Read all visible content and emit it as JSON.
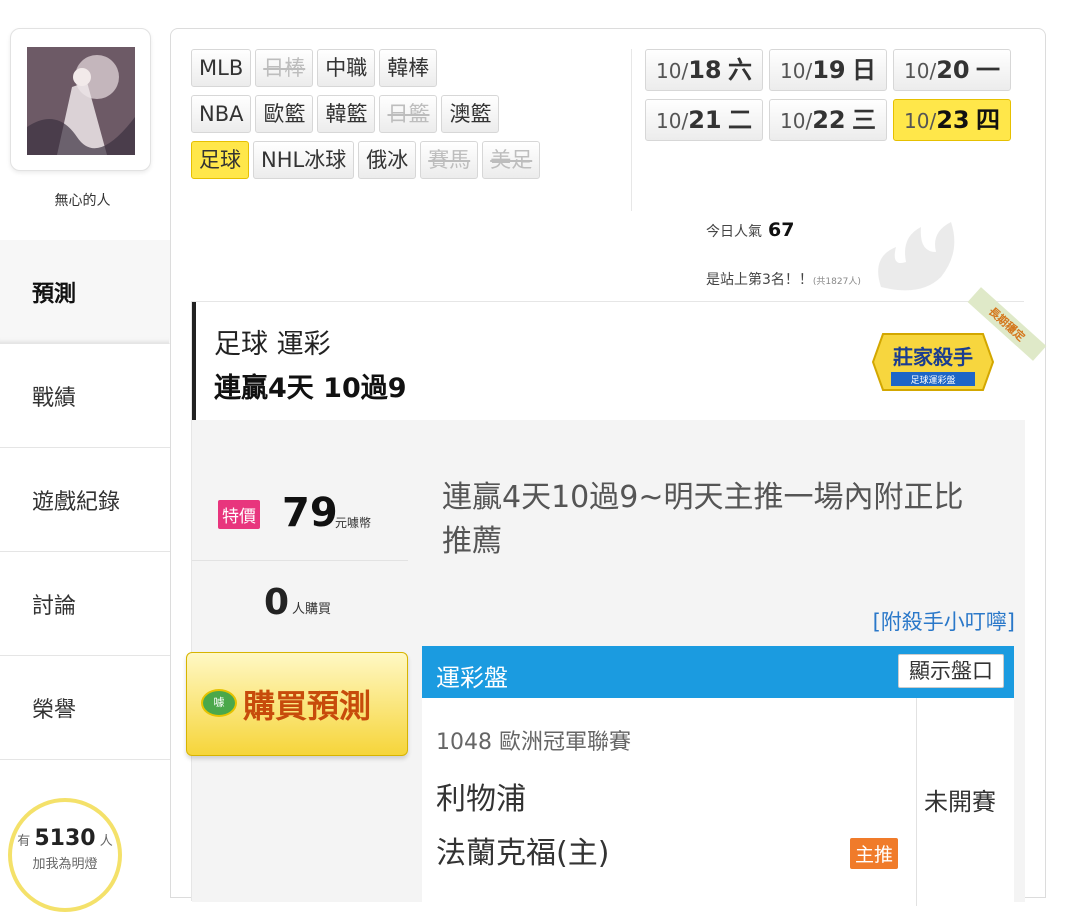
{
  "user": {
    "name": "無心的人"
  },
  "nav": {
    "items": [
      {
        "label": "預測"
      },
      {
        "label": "戰績"
      },
      {
        "label": "遊戲紀錄"
      },
      {
        "label": "討論"
      },
      {
        "label": "榮譽"
      }
    ]
  },
  "fans": {
    "prefix": "有",
    "count": "5130",
    "suffix": "人",
    "caption": "加我為明燈"
  },
  "sports": [
    {
      "label": "MLB"
    },
    {
      "label": "日棒"
    },
    {
      "label": "中職"
    },
    {
      "label": "韓棒"
    },
    {
      "label": "NBA"
    },
    {
      "label": "歐籃"
    },
    {
      "label": "韓籃"
    },
    {
      "label": "日籃"
    },
    {
      "label": "澳籃"
    },
    {
      "label": "足球"
    },
    {
      "label": "NHL冰球"
    },
    {
      "label": "俄冰"
    },
    {
      "label": "賽馬"
    },
    {
      "label": "美足"
    }
  ],
  "dates": [
    {
      "month": "10/",
      "day": "18",
      "weekday": "六"
    },
    {
      "month": "10/",
      "day": "19",
      "weekday": "日"
    },
    {
      "month": "10/",
      "day": "20",
      "weekday": "一"
    },
    {
      "month": "10/",
      "day": "21",
      "weekday": "二"
    },
    {
      "month": "10/",
      "day": "22",
      "weekday": "三"
    },
    {
      "month": "10/",
      "day": "23",
      "weekday": "四"
    }
  ],
  "stats": {
    "popularity_label": "今日人氣",
    "popularity_value": "67",
    "rank_text": "是站上第3名！！",
    "rank_total": "(共1827人)"
  },
  "prediction": {
    "category": "足球 運彩",
    "streak": "連贏4天 10過9",
    "badge_title": "莊家殺手",
    "badge_subtitle": "足球運彩盤",
    "ribbon": "長期穩定",
    "special_tag": "特價",
    "price": "79",
    "currency": "元噱幣",
    "buyers": "0",
    "buyers_label": "人購買",
    "description": "連贏4天10過9~明天主推一場內附正比推薦",
    "tip_link": "[附殺手小叮嚀]",
    "buy_icon": "噱",
    "buy_label": "購買預測"
  },
  "table": {
    "header": "運彩盤",
    "show_odds": "顯示盤口",
    "match_id": "1048 歐洲冠軍聯賽",
    "team_away": "利物浦",
    "team_home": "法蘭克福(主)",
    "status": "未開賽",
    "main_pick": "主推"
  },
  "colors": {
    "accent_yellow": "#ffe74a",
    "table_blue": "#1b9be0",
    "tag_pink": "#e8357d",
    "pick_orange": "#f07b2a"
  }
}
